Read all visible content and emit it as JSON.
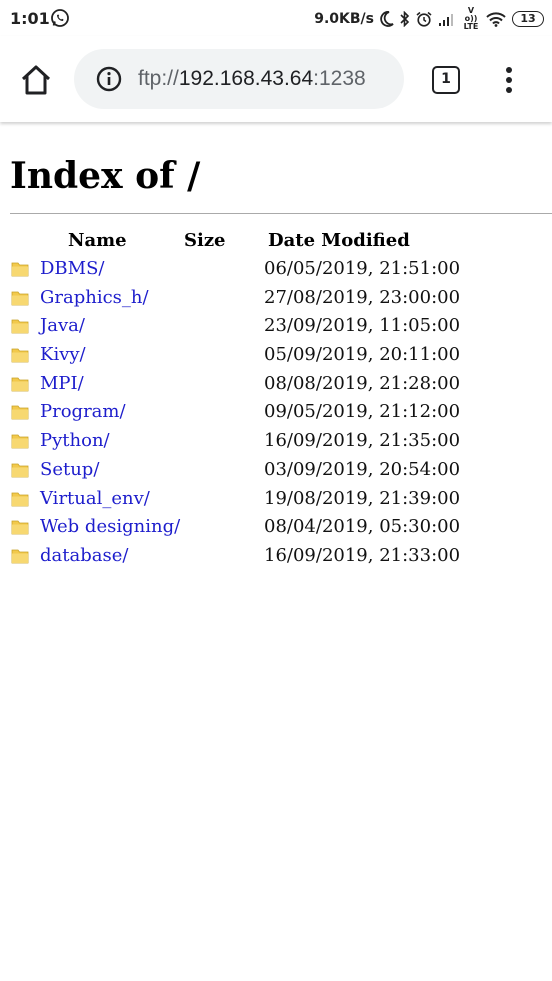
{
  "status_bar": {
    "time": "1:01",
    "network_speed": "9.0KB/s",
    "volte_label": "Vo)) LTE",
    "battery_level": "13",
    "icons": [
      "whatsapp-icon",
      "moon-icon",
      "bluetooth-icon",
      "alarm-icon",
      "signal-icon",
      "volte-icon",
      "wifi-icon",
      "battery-icon"
    ]
  },
  "toolbar": {
    "home_icon": "home-icon",
    "info_icon": "info-icon",
    "url_scheme": "ftp://",
    "url_host": "192.168.43.64",
    "url_port": ":1238",
    "tab_count": "1",
    "menu_icon": "more-vert-icon"
  },
  "page": {
    "title": "Index of /",
    "columns": {
      "name": "Name",
      "size": "Size",
      "date": "Date Modified"
    },
    "entries": [
      {
        "name": "DBMS/",
        "size": "",
        "date": "06/05/2019, 21:51:00"
      },
      {
        "name": "Graphics_h/",
        "size": "",
        "date": "27/08/2019, 23:00:00"
      },
      {
        "name": "Java/",
        "size": "",
        "date": "23/09/2019, 11:05:00"
      },
      {
        "name": "Kivy/",
        "size": "",
        "date": "05/09/2019, 20:11:00"
      },
      {
        "name": "MPI/",
        "size": "",
        "date": "08/08/2019, 21:28:00"
      },
      {
        "name": "Program/",
        "size": "",
        "date": "09/05/2019, 21:12:00"
      },
      {
        "name": "Python/",
        "size": "",
        "date": "16/09/2019, 21:35:00"
      },
      {
        "name": "Setup/",
        "size": "",
        "date": "03/09/2019, 20:54:00"
      },
      {
        "name": "Virtual_env/",
        "size": "",
        "date": "19/08/2019, 21:39:00"
      },
      {
        "name": "Web designing/",
        "size": "",
        "date": "08/04/2019, 05:30:00"
      },
      {
        "name": "database/",
        "size": "",
        "date": "16/09/2019, 21:33:00"
      }
    ]
  },
  "colors": {
    "link": "#1d1dcc",
    "folder": "#f2c94c",
    "url_bar_bg": "#f1f3f4"
  }
}
